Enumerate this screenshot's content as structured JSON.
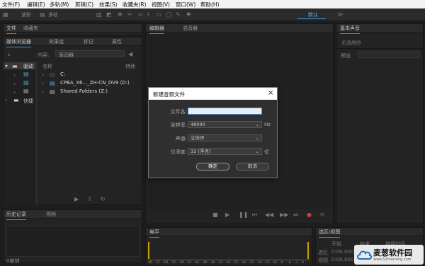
{
  "menu": [
    "文件(F)",
    "编辑(E)",
    "多轨(M)",
    "剪辑(C)",
    "效果(S)",
    "收藏夹(R)",
    "视图(V)",
    "窗口(W)",
    "帮助(H)"
  ],
  "toolbar": {
    "waveform": "波形",
    "multitrack": "多轨",
    "workspace": "默认"
  },
  "files_panel": {
    "tab_files": "文件",
    "tab_favorites": "收藏夹"
  },
  "media_browser": {
    "tabs": [
      "媒体浏览器",
      "效果组",
      "标记",
      "属性"
    ],
    "content_label": "内容:",
    "content_value": "驱动器",
    "tree_drive": "驱动",
    "tree_shortcut": "快捷",
    "col_name": "名称",
    "col_duration": "持续",
    "rows": [
      "C:",
      "CPBA_X6..._ZH-CN_DV9 (D:)",
      "Shared Folders (Z:)"
    ]
  },
  "history_panel": {
    "tab_history": "历史记录",
    "tab_video": "视频",
    "undo_count": "0撤销"
  },
  "editor": {
    "tab_editor": "编辑器",
    "tab_mixer": "混音器"
  },
  "essential_sound": {
    "title": "基本声音",
    "no_selection": "无选择的",
    "preset_label": "预设"
  },
  "levels": {
    "title": "电平",
    "ruler": [
      "dB",
      "-57",
      "-54",
      "-51",
      "-48",
      "-45",
      "-42",
      "-39",
      "-36",
      "-33",
      "-30",
      "-27",
      "-24",
      "-21",
      "-18",
      "-15",
      "-12",
      "-9",
      "-6",
      "-3",
      "0"
    ]
  },
  "selection": {
    "title": "选区/视图",
    "col_start": "开始",
    "col_end": "结束",
    "col_duration": "持续时间",
    "row_selection": "选区",
    "row_view": "视图",
    "time": "0:00.000"
  },
  "dialog": {
    "title": "新建音频文件",
    "filename_label": "文件名:",
    "filename_value": "",
    "samplerate_label": "采样率:",
    "samplerate_value": "48000",
    "samplerate_unit": "Hz",
    "channels_label": "声道:",
    "channels_value": "立体声",
    "bitdepth_label": "位深度:",
    "bitdepth_value": "32 (浮点)",
    "bitdepth_unit": "位",
    "ok": "确定",
    "cancel": "取消"
  },
  "watermark": {
    "name": "麦葱软件园",
    "url": "www.52maicong.com"
  },
  "colors": {
    "accent": "#3a8fd6",
    "record": "#d23b3b",
    "level": "#c9a000"
  }
}
